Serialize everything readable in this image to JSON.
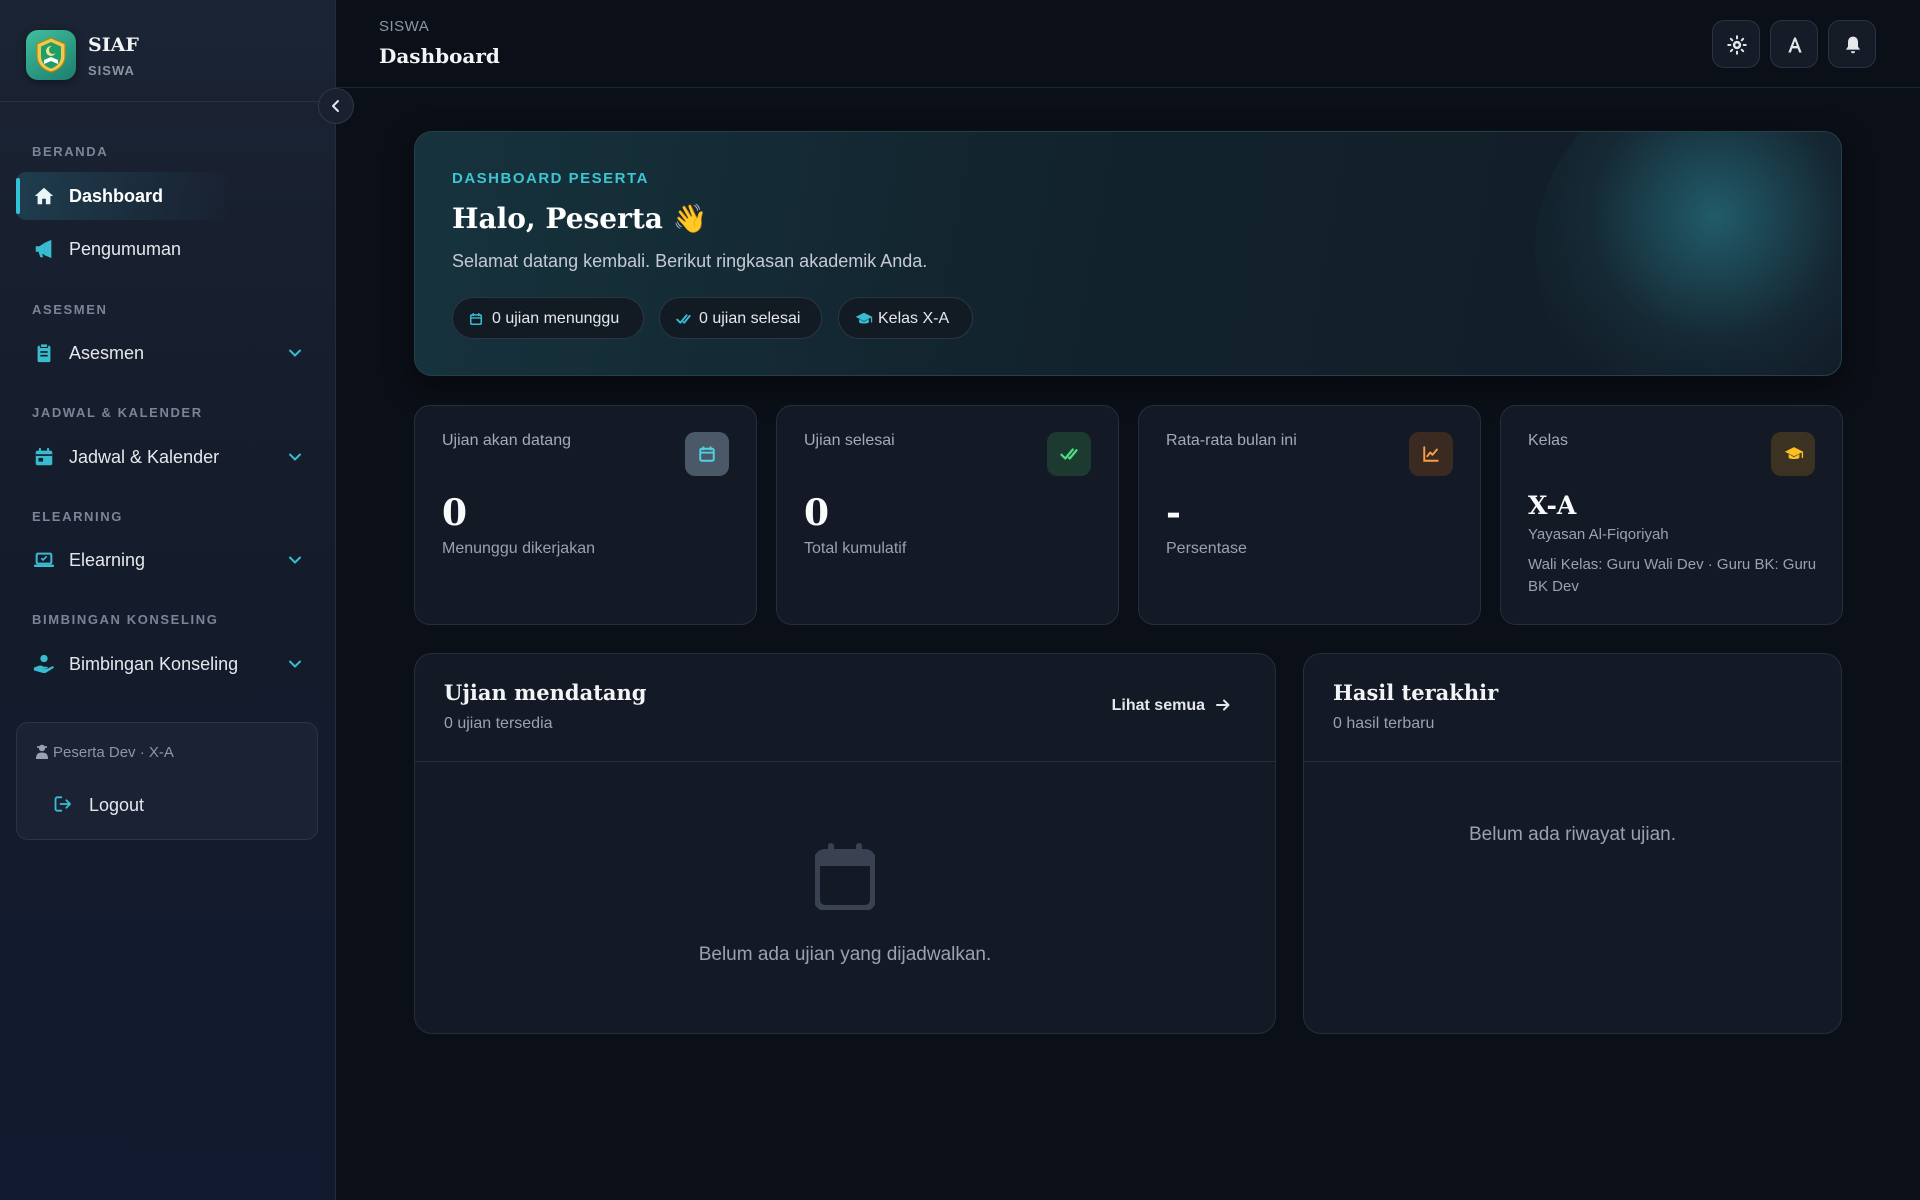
{
  "sidebar": {
    "brand_title": "SIAF",
    "brand_sub": "SISWA",
    "sections": [
      {
        "label": "BERANDA"
      },
      {
        "label": "ASESMEN"
      },
      {
        "label": "JADWAL & KALENDER"
      },
      {
        "label": "ELEARNING"
      },
      {
        "label": "BIMBINGAN KONSELING"
      }
    ],
    "items": {
      "dashboard": "Dashboard",
      "pengumuman": "Pengumuman",
      "asesmen": "Asesmen",
      "jadwal": "Jadwal & Kalender",
      "elearning": "Elearning",
      "bk": "Bimbingan Konseling"
    },
    "user": "Peserta Dev · X-A",
    "logout": "Logout"
  },
  "topbar": {
    "breadcrumb": "SISWA",
    "title": "Dashboard"
  },
  "hero": {
    "eyebrow": "DASHBOARD PESERTA",
    "title": "Halo, Peserta 👋",
    "subtitle": "Selamat datang kembali. Berikut ringkasan akademik Anda.",
    "pills": [
      "0 ujian menunggu",
      "0 ujian selesai",
      "Kelas X-A"
    ]
  },
  "stats": [
    {
      "label": "Ujian akan datang",
      "value": "0",
      "foot": "Menunggu dikerjakan",
      "icon": "calendar-icon"
    },
    {
      "label": "Ujian selesai",
      "value": "0",
      "foot": "Total kumulatif",
      "icon": "check-double-icon"
    },
    {
      "label": "Rata-rata bulan ini",
      "value": "-",
      "foot": "Persentase",
      "icon": "chart-line-icon"
    },
    {
      "label": "Kelas",
      "value": "X-A",
      "org": "Yayasan Al-Fiqoriyah",
      "wali": "Wali Kelas: Guru Wali Dev · Guru BK: Guru BK Dev",
      "icon": "graduation-cap-icon"
    }
  ],
  "upcoming": {
    "title": "Ujian mendatang",
    "subtitle": "0 ujian tersedia",
    "see_all": "Lihat semua",
    "empty": "Belum ada ujian yang dijadwalkan."
  },
  "results": {
    "title": "Hasil terakhir",
    "subtitle": "0 hasil terbaru",
    "empty": "Belum ada riwayat ujian."
  },
  "colors": {
    "accent": "#34c3d6",
    "background": "#0b0f17",
    "card": "#131925",
    "green": "#4ade80",
    "orange": "#f59e42",
    "gold": "#fbbf24"
  }
}
